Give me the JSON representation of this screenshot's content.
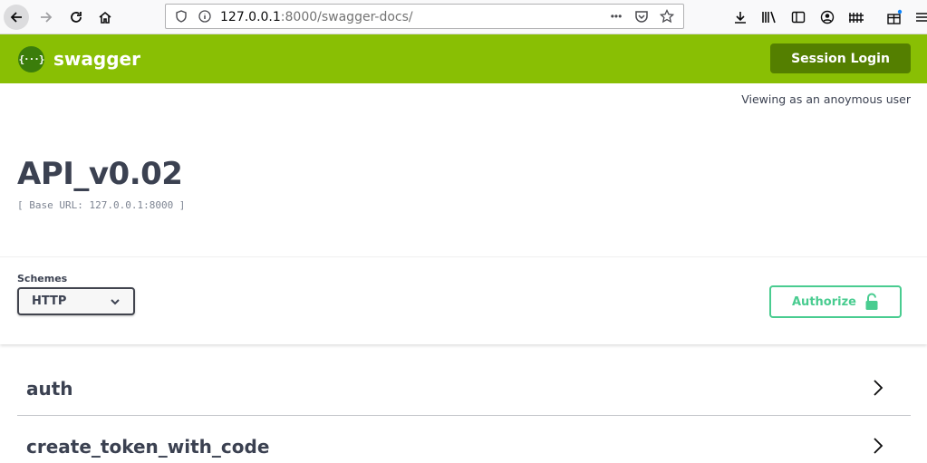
{
  "browser": {
    "url_host": "127.0.0.1",
    "url_path": ":8000/swagger-docs/",
    "overflow_menu": "•••"
  },
  "topbar": {
    "logo_symbol": "{···}",
    "logo_text": "swagger",
    "session_login": "Session Login"
  },
  "viewing_text": "Viewing as an anoymous user",
  "info": {
    "title": "API_v0.02",
    "base_url": "[ Base URL: 127.0.0.1:8000 ]"
  },
  "schemes": {
    "label": "Schemes",
    "selected": "HTTP",
    "authorize": "Authorize"
  },
  "tags": [
    {
      "name": "auth"
    },
    {
      "name": "create_token_with_code"
    }
  ],
  "colors": {
    "topbar": "#89bf04",
    "session_button": "#547f00",
    "authorize": "#49cc90",
    "text": "#3b4151"
  }
}
